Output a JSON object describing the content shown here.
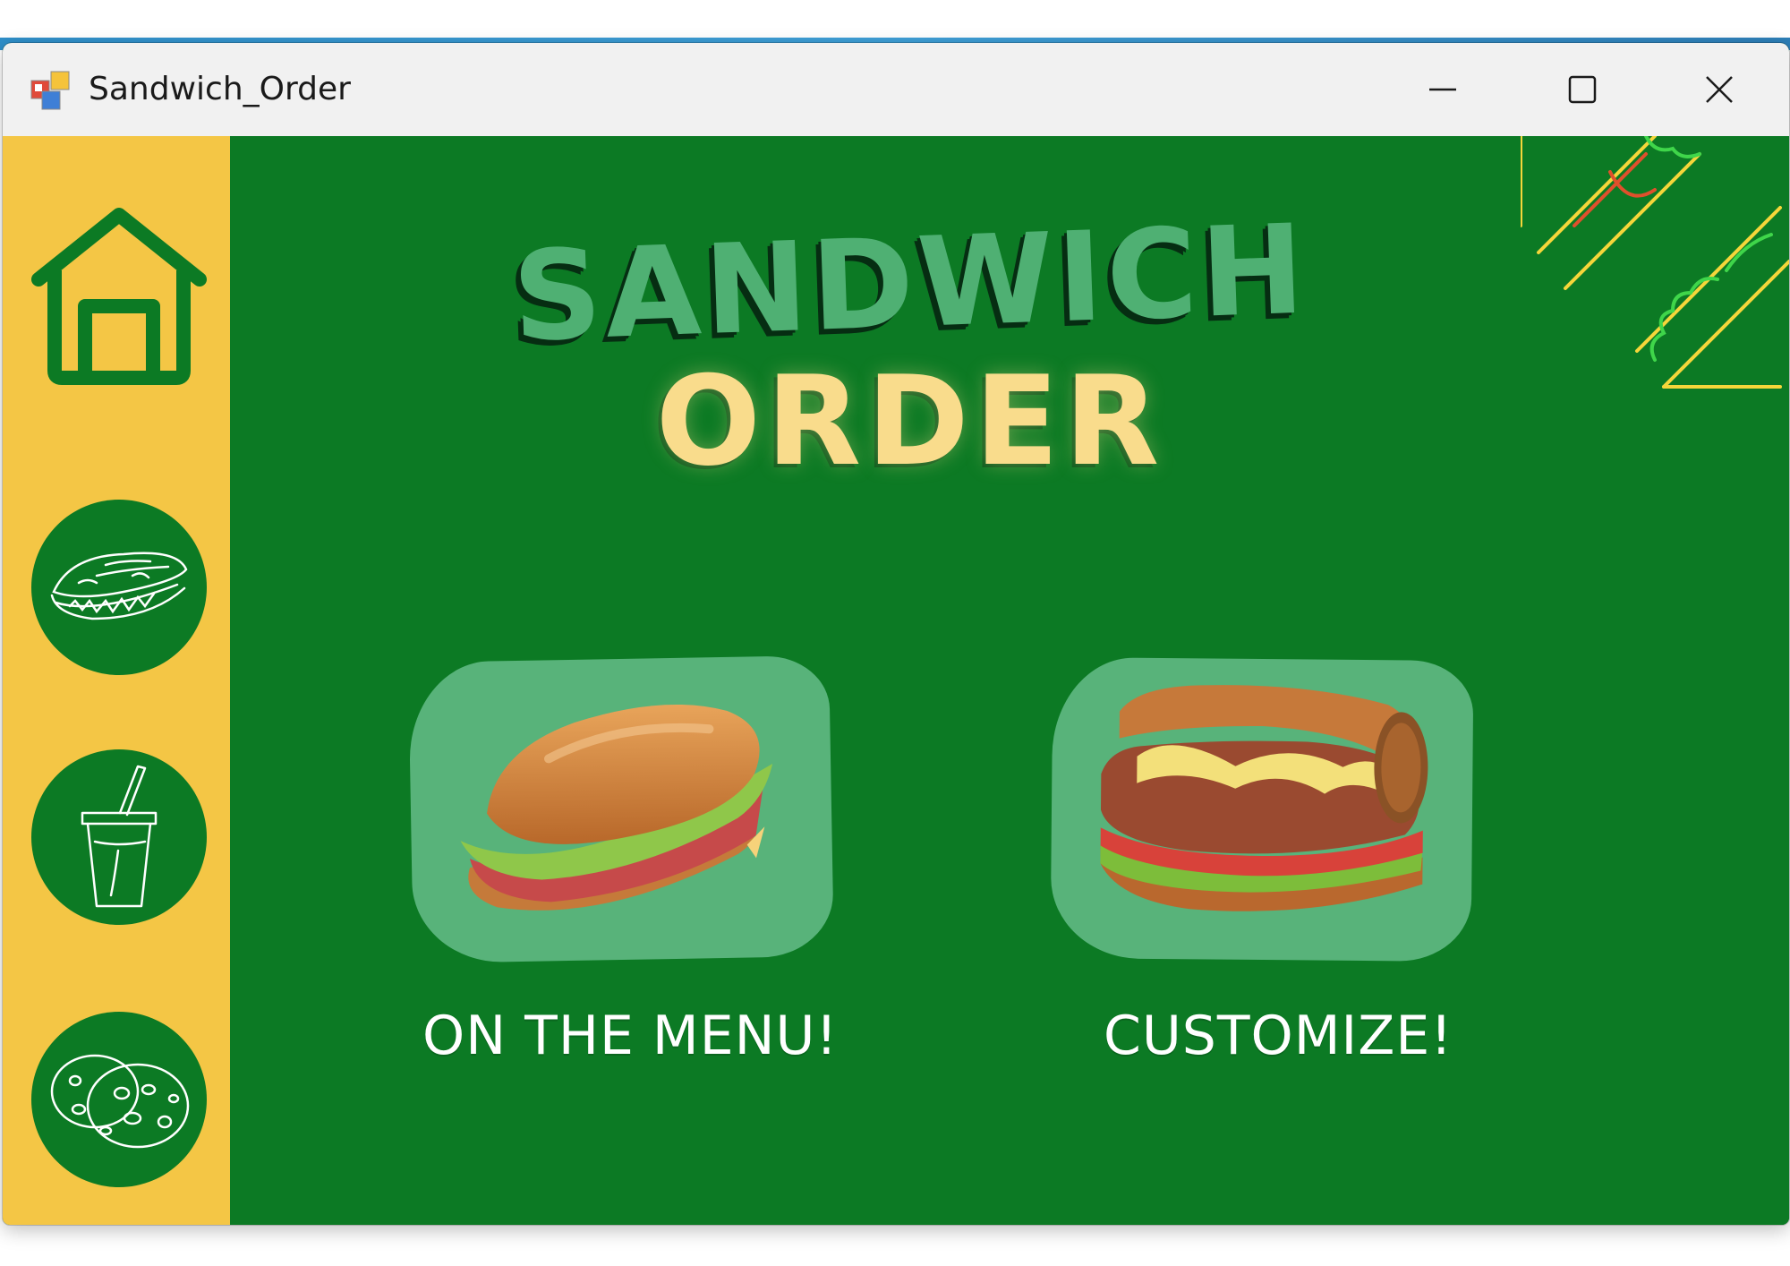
{
  "window": {
    "title": "Sandwich_Order",
    "controls": [
      "minimize-icon",
      "maximize-icon",
      "close-icon"
    ]
  },
  "sidebar": {
    "items": [
      {
        "name": "home",
        "icon": "home-icon"
      },
      {
        "name": "sandwiches",
        "icon": "sandwich-sketch-icon"
      },
      {
        "name": "drinks",
        "icon": "drink-cup-icon"
      },
      {
        "name": "cookies",
        "icon": "cookie-sketch-icon"
      }
    ]
  },
  "header": {
    "title_line1": "SANDWICH",
    "title_line2": "ORDER"
  },
  "options": [
    {
      "label": "ON THE MENU!",
      "image": "sub-sandwich-image"
    },
    {
      "label": "CUSTOMIZE!",
      "image": "loaded-sub-sandwich-image"
    }
  ],
  "colors": {
    "main_bg": "#0c7a24",
    "sidebar_bg": "#f4c645",
    "card_bg": "#58b37a",
    "title_green": "#4fb073",
    "title_cream": "#f9dc8c",
    "titlebar_bg": "#f1f1f1"
  }
}
